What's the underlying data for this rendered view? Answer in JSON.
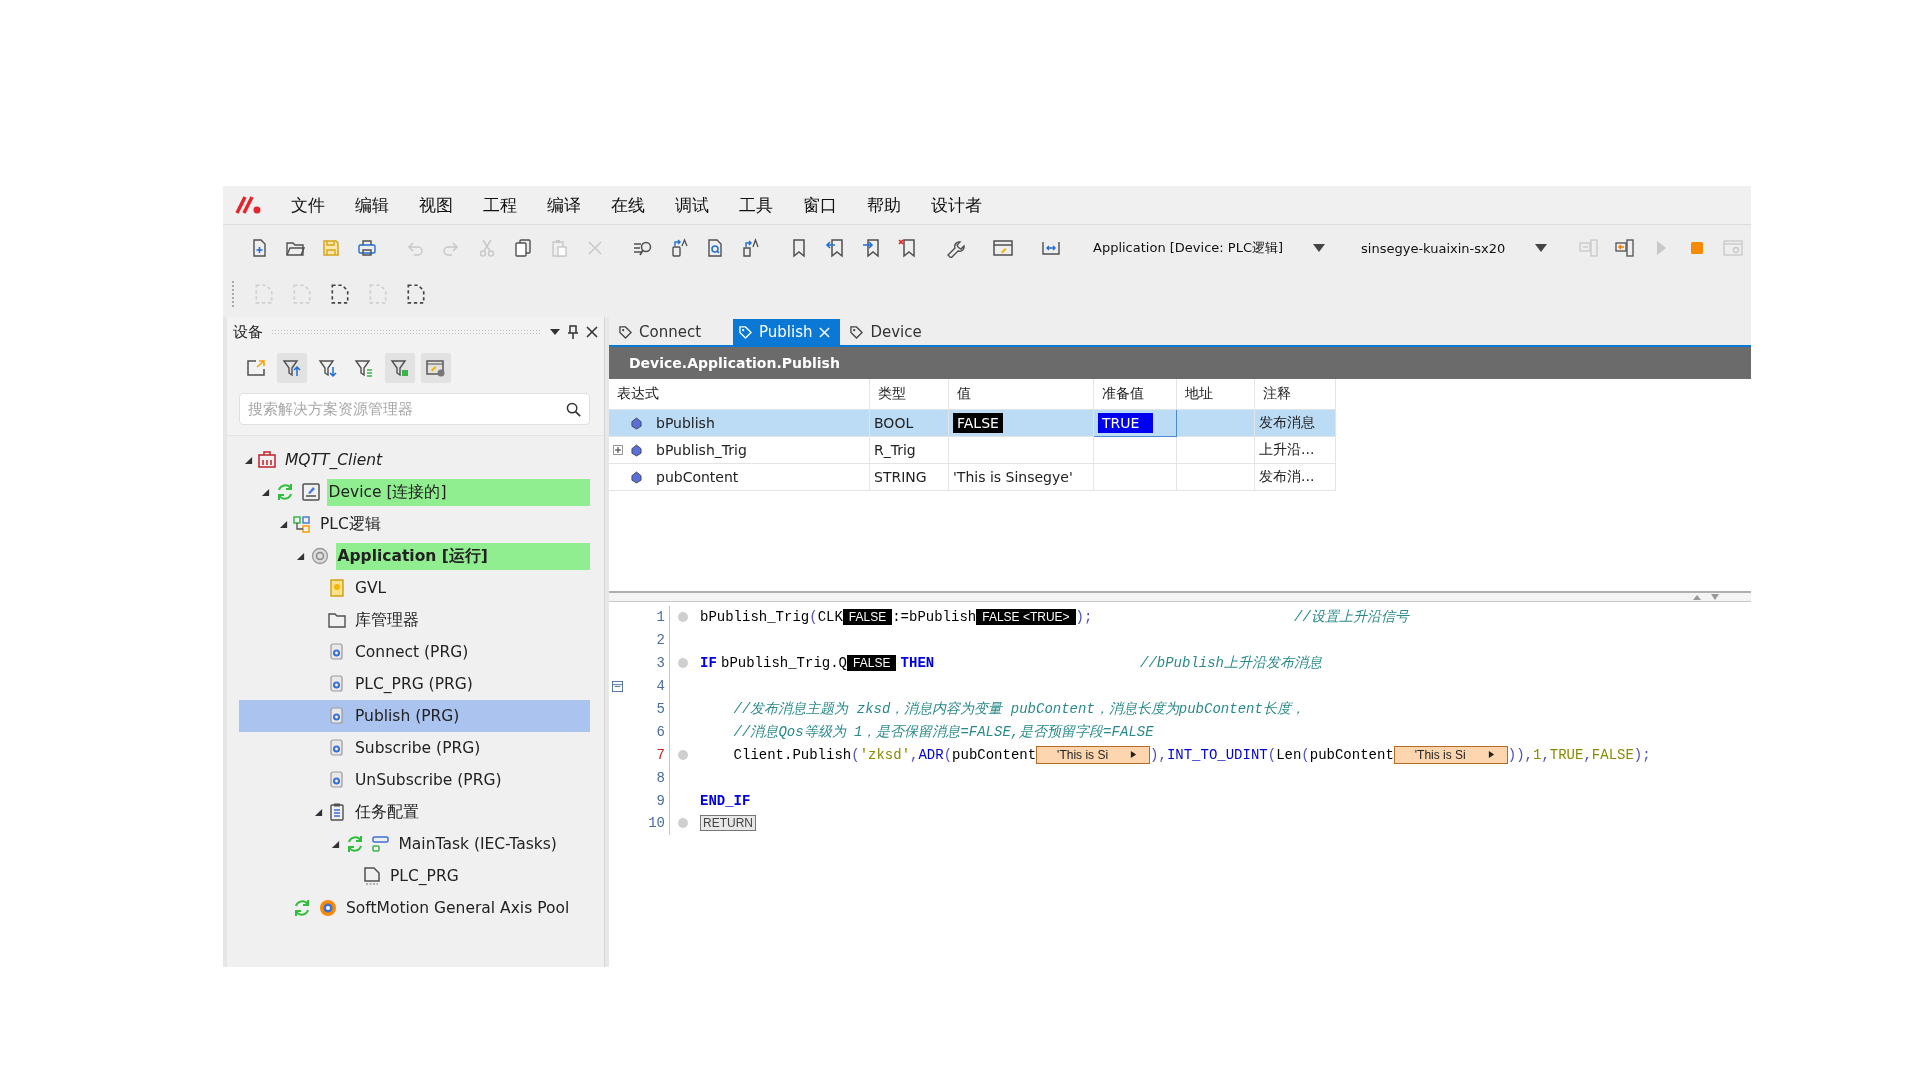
{
  "menu": {
    "items": [
      "文件",
      "编辑",
      "视图",
      "工程",
      "编译",
      "在线",
      "调试",
      "工具",
      "窗口",
      "帮助",
      "设计者"
    ]
  },
  "toolbar": {
    "rows": [
      [
        {
          "kind": "new",
          "disabled": false
        },
        {
          "kind": "open",
          "disabled": false
        },
        {
          "kind": "save",
          "disabled": false
        },
        {
          "kind": "print",
          "disabled": false
        },
        {
          "kind": "sep"
        },
        {
          "kind": "undo",
          "disabled": true
        },
        {
          "kind": "redo",
          "disabled": true
        },
        {
          "kind": "cut",
          "disabled": true
        },
        {
          "kind": "copy",
          "disabled": false
        },
        {
          "kind": "paste",
          "disabled": true
        },
        {
          "kind": "delete",
          "disabled": true
        },
        {
          "kind": "sep"
        },
        {
          "kind": "find",
          "disabled": false
        },
        {
          "kind": "replace",
          "disabled": false
        },
        {
          "kind": "find-file",
          "disabled": false
        },
        {
          "kind": "replace-file",
          "disabled": false
        },
        {
          "kind": "sep"
        },
        {
          "kind": "bookmark",
          "disabled": false
        },
        {
          "kind": "bm-prev",
          "disabled": false
        },
        {
          "kind": "bm-next",
          "disabled": false
        },
        {
          "kind": "bm-clear",
          "disabled": false
        },
        {
          "kind": "sep"
        },
        {
          "kind": "wrench",
          "disabled": false
        },
        {
          "kind": "sep"
        },
        {
          "kind": "window",
          "disabled": false
        },
        {
          "kind": "sep"
        },
        {
          "kind": "link",
          "disabled": false
        },
        {
          "kind": "sep"
        },
        {
          "kind": "combo",
          "value": "Application [Device: PLC逻辑]"
        },
        {
          "kind": "combo",
          "value": "sinsegye-kuaixin-sx20"
        },
        {
          "kind": "login",
          "disabled": true
        },
        {
          "kind": "logout",
          "disabled": false
        },
        {
          "kind": "run",
          "disabled": true
        },
        {
          "kind": "stop",
          "disabled": false
        },
        {
          "kind": "sim",
          "disabled": true
        }
      ],
      [
        {
          "kind": "frame",
          "disabled": true
        },
        {
          "kind": "frame",
          "disabled": true
        },
        {
          "kind": "frame",
          "disabled": false
        },
        {
          "kind": "frame",
          "disabled": true
        },
        {
          "kind": "frame",
          "disabled": false
        }
      ]
    ]
  },
  "devices_panel": {
    "title": "设备",
    "tools": [
      {
        "kind": "export",
        "pressed": false
      },
      {
        "kind": "filter-up",
        "pressed": true
      },
      {
        "kind": "filter-down",
        "pressed": false
      },
      {
        "kind": "filter-list",
        "pressed": false
      },
      {
        "kind": "filter-add",
        "pressed": true
      },
      {
        "kind": "settings",
        "pressed": true
      }
    ],
    "search": {
      "placeholder": "搜索解决方案资源管理器"
    },
    "tree": [
      {
        "label": "MQTT_Client",
        "kind": "project",
        "expanded": true,
        "selected": false,
        "highlighted": false,
        "sync": false,
        "children": [
          {
            "label": "Device [连接的]",
            "kind": "device",
            "expanded": true,
            "selected": false,
            "highlighted": true,
            "sync": true,
            "children": [
              {
                "label": "PLC逻辑",
                "kind": "plc",
                "expanded": true,
                "selected": false,
                "highlighted": false,
                "sync": false,
                "children": [
                  {
                    "label": "Application [运行]",
                    "kind": "app",
                    "expanded": true,
                    "selected": false,
                    "highlighted": true,
                    "sync": false,
                    "children": [
                      {
                        "label": "GVL",
                        "kind": "gvl",
                        "selected": false,
                        "highlighted": false,
                        "sync": false
                      },
                      {
                        "label": "库管理器",
                        "kind": "library",
                        "selected": false,
                        "highlighted": false,
                        "sync": false
                      },
                      {
                        "label": "Connect (PRG)",
                        "kind": "pou",
                        "selected": false,
                        "highlighted": false,
                        "sync": false
                      },
                      {
                        "label": "PLC_PRG (PRG)",
                        "kind": "pou",
                        "selected": false,
                        "highlighted": false,
                        "sync": false
                      },
                      {
                        "label": "Publish (PRG)",
                        "kind": "pou",
                        "selected": true,
                        "highlighted": false,
                        "sync": false
                      },
                      {
                        "label": "Subscribe (PRG)",
                        "kind": "pou",
                        "selected": false,
                        "highlighted": false,
                        "sync": false
                      },
                      {
                        "label": "UnSubscribe (PRG)",
                        "kind": "pou",
                        "selected": false,
                        "highlighted": false,
                        "sync": false
                      },
                      {
                        "label": "任务配置",
                        "kind": "tasks",
                        "expanded": true,
                        "selected": false,
                        "highlighted": false,
                        "sync": false,
                        "children": [
                          {
                            "label": "MainTask (IEC-Tasks)",
                            "kind": "task",
                            "expanded": true,
                            "selected": false,
                            "highlighted": false,
                            "sync": true,
                            "children": [
                              {
                                "label": "PLC_PRG",
                                "kind": "call",
                                "selected": false,
                                "highlighted": false,
                                "sync": false
                              }
                            ]
                          }
                        ]
                      }
                    ]
                  }
                ]
              },
              {
                "label": "SoftMotion General Axis Pool",
                "kind": "axis",
                "selected": false,
                "highlighted": false,
                "sync": true
              }
            ]
          }
        ]
      }
    ]
  },
  "tabs": [
    {
      "label": "Connect",
      "selected": false
    },
    {
      "label": "Publish",
      "selected": true
    },
    {
      "label": "Device",
      "selected": false
    }
  ],
  "watch": {
    "path": "Device.Application.Publish",
    "columns": [
      "表达式",
      "类型",
      "值",
      "准备值",
      "地址",
      "注释"
    ],
    "rows": [
      {
        "expandable": false,
        "selected": true,
        "expression": "bPublish",
        "type": "BOOL",
        "value": "FALSE",
        "value_boxed": true,
        "prepared": "TRUE",
        "comment": "发布消息"
      },
      {
        "expandable": true,
        "selected": false,
        "expression": "bPublish_Trig",
        "type": "R_Trig",
        "comment": "上升沿..."
      },
      {
        "expandable": false,
        "selected": false,
        "expression": "pubContent",
        "type": "STRING",
        "value": "'This is Sinsegye'",
        "value_boxed": false,
        "comment": "发布消..."
      }
    ]
  },
  "code": {
    "lines": [
      {
        "number": "1",
        "dot": true,
        "current": false,
        "fold": false,
        "indented": false,
        "tokens": [
          {
            "kind": "id",
            "text": "bPublish_Trig"
          },
          {
            "kind": "punc",
            "text": "("
          },
          {
            "kind": "id",
            "text": "CLK"
          },
          {
            "kind": "val",
            "text": "FALSE"
          },
          {
            "kind": "id",
            "text": ":=bPublish"
          },
          {
            "kind": "val",
            "text": "FALSE <TRUE>"
          },
          {
            "kind": "punc",
            "text": ");"
          },
          {
            "kind": "tail",
            "text": "//设置上升沿信号"
          }
        ]
      },
      {
        "number": "2",
        "dot": false,
        "current": false,
        "fold": false
      },
      {
        "number": "3",
        "dot": true,
        "current": false,
        "fold": false,
        "indented": false,
        "tokens": [
          {
            "kind": "kw",
            "text": "IF"
          },
          {
            "kind": "id",
            "text": "bPublish_Trig.Q"
          },
          {
            "kind": "val",
            "text": "FALSE"
          },
          {
            "kind": "kw",
            "text": "THEN"
          },
          {
            "kind": "tail",
            "text": "//bPublish上升沿发布消息"
          }
        ]
      },
      {
        "number": "4",
        "dot": false,
        "current": false,
        "fold": true
      },
      {
        "number": "5",
        "dot": false,
        "current": false,
        "fold": false,
        "indented": true,
        "tokens": [
          {
            "kind": "cmt",
            "text": "//发布消息主题为 zksd，消息内容为变量 pubContent，消息长度为pubContent长度，"
          }
        ]
      },
      {
        "number": "6",
        "dot": false,
        "current": false,
        "fold": false,
        "indented": true,
        "tokens": [
          {
            "kind": "cmt",
            "text": "//消息Qos等级为 1，是否保留消息=FALSE,是否预留字段=FALSE"
          }
        ]
      },
      {
        "number": "7",
        "dot": true,
        "current": true,
        "fold": false,
        "indented": true,
        "tokens": [
          {
            "kind": "id",
            "text": "Client.Publish"
          },
          {
            "kind": "punc",
            "text": "("
          },
          {
            "kind": "str",
            "text": "'zksd'"
          },
          {
            "kind": "punc",
            "text": ","
          },
          {
            "kind": "fn",
            "text": "ADR"
          },
          {
            "kind": "punc",
            "text": "("
          },
          {
            "kind": "id",
            "text": "pubContent"
          },
          {
            "kind": "mon",
            "text": "'This is Si"
          },
          {
            "kind": "punc",
            "text": "),"
          },
          {
            "kind": "fn",
            "text": "INT_TO_UDINT"
          },
          {
            "kind": "punc",
            "text": "("
          },
          {
            "kind": "id",
            "text": "Len"
          },
          {
            "kind": "punc",
            "text": "("
          },
          {
            "kind": "id",
            "text": "pubContent"
          },
          {
            "kind": "mon",
            "text": "'This is Si"
          },
          {
            "kind": "punc",
            "text": ")),"
          },
          {
            "kind": "lit",
            "text": "1"
          },
          {
            "kind": "punc",
            "text": ","
          },
          {
            "kind": "lit",
            "text": "TRUE"
          },
          {
            "kind": "punc",
            "text": ","
          },
          {
            "kind": "lit",
            "text": "FALSE"
          },
          {
            "kind": "punc",
            "text": ");"
          }
        ]
      },
      {
        "number": "8",
        "dot": false,
        "current": false,
        "fold": false
      },
      {
        "number": "9",
        "dot": false,
        "current": false,
        "fold": false,
        "indented": false,
        "tokens": [
          {
            "kind": "kw",
            "text": "END_IF"
          }
        ]
      },
      {
        "number": "10",
        "dot": true,
        "current": false,
        "fold": false,
        "indented": false,
        "tokens": [
          {
            "kind": "ret",
            "text": "RETURN"
          }
        ]
      }
    ]
  }
}
